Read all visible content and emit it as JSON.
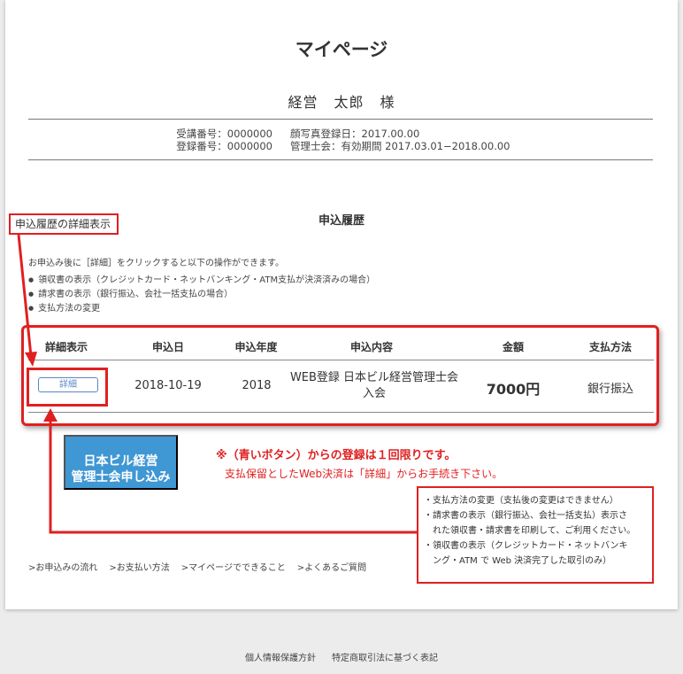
{
  "page": {
    "title": "マイページ",
    "user": {
      "family": "経営",
      "given": "太郎",
      "honorific": "様"
    }
  },
  "member_info": {
    "lines_left": [
      "受講番号：0000000",
      "登録番号：0000000"
    ],
    "lines_right": [
      "顔写真登録日：2017.00.00",
      "管理士会：有効期間 2017.03.01−2018.00.00"
    ]
  },
  "history": {
    "title": "申込履歴",
    "description": "お申込み後に［詳細］をクリックすると以下の操作ができます。",
    "bullets": [
      "領収書の表示（クレジットカード・ネットバンキング・ATM支払が決済済みの場合）",
      "請求書の表示（銀行振込、会社一括支払の場合）",
      "支払方法の変更"
    ],
    "table": {
      "headers": [
        "詳細表示",
        "申込日",
        "申込年度",
        "申込内容",
        "金額",
        "支払方法"
      ],
      "rows": [
        {
          "detail_label": "詳細",
          "date": "2018-10-19",
          "year": "2018",
          "content_line1": "WEB登録 日本ビル経営管理士会",
          "content_line2": "入会",
          "amount": "7000円",
          "method": "銀行振込"
        }
      ]
    }
  },
  "apply_button": {
    "line1": "日本ビル経営",
    "line2": "管理士会申し込み"
  },
  "notice": {
    "line1": "※（青いボタン）からの登録は１回限りです。",
    "line2": "支払保留としたWeb決済は「詳細」からお手続き下さい。"
  },
  "annotation": {
    "label": "申込履歴の詳細表示",
    "info_lines": [
      "・支払方法の変更（支払後の変更はできません）",
      "・請求書の表示（銀行振込、会社一括支払）表示さ",
      "　れた領収書・請求書を印刷して、ご利用ください。",
      "・領収書の表示（クレジットカード・ネットバンキ",
      "　ング・ATM で Web 決済完了した取引のみ）"
    ]
  },
  "links": [
    ">お申込みの流れ",
    ">お支払い方法",
    ">マイページでできること",
    ">よくあるご質問"
  ],
  "footer": [
    "個人情報保護方針",
    "特定商取引法に基づく表記"
  ],
  "colors": {
    "accent_red": "#e02020",
    "button_blue": "#3f97d3",
    "link_blue": "#5b88c7"
  },
  "icons": [
    "bullet-dot-icon",
    "arrow-head-icon"
  ]
}
